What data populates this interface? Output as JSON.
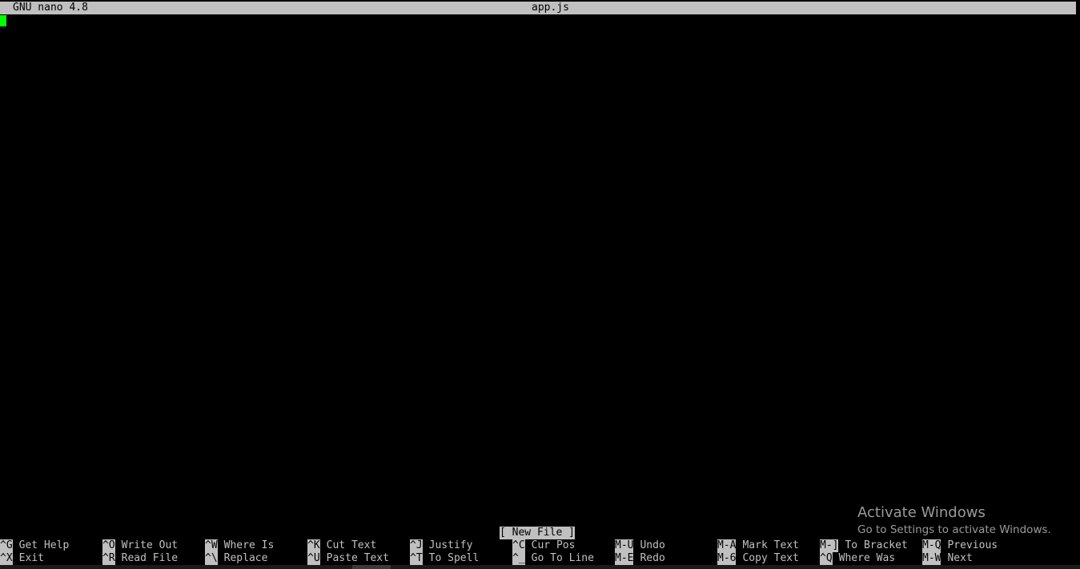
{
  "title_bar": {
    "version": "GNU nano 4.8",
    "filename": "app.js"
  },
  "status_message": "[ New File ]",
  "shortcuts": {
    "row1": [
      {
        "key": "^G",
        "label": "Get Help"
      },
      {
        "key": "^O",
        "label": "Write Out"
      },
      {
        "key": "^W",
        "label": "Where Is"
      },
      {
        "key": "^K",
        "label": "Cut Text"
      },
      {
        "key": "^J",
        "label": "Justify"
      },
      {
        "key": "^C",
        "label": "Cur Pos"
      },
      {
        "key": "M-U",
        "label": "Undo"
      },
      {
        "key": "M-A",
        "label": "Mark Text"
      },
      {
        "key": "M-]",
        "label": "To Bracket"
      },
      {
        "key": "M-Q",
        "label": "Previous"
      }
    ],
    "row2": [
      {
        "key": "^X",
        "label": "Exit"
      },
      {
        "key": "^R",
        "label": "Read File"
      },
      {
        "key": "^\\",
        "label": "Replace"
      },
      {
        "key": "^U",
        "label": "Paste Text"
      },
      {
        "key": "^T",
        "label": "To Spell"
      },
      {
        "key": "^_",
        "label": "Go To Line"
      },
      {
        "key": "M-E",
        "label": "Redo"
      },
      {
        "key": "M-6",
        "label": "Copy Text"
      },
      {
        "key": "^Q",
        "label": "Where Was"
      },
      {
        "key": "M-W",
        "label": "Next"
      }
    ]
  },
  "watermark": {
    "title": "Activate Windows",
    "subtitle": "Go to Settings to activate Windows."
  },
  "colors": {
    "background": "#000000",
    "bar": "#c0c0c0",
    "cursor": "#00ff00"
  }
}
